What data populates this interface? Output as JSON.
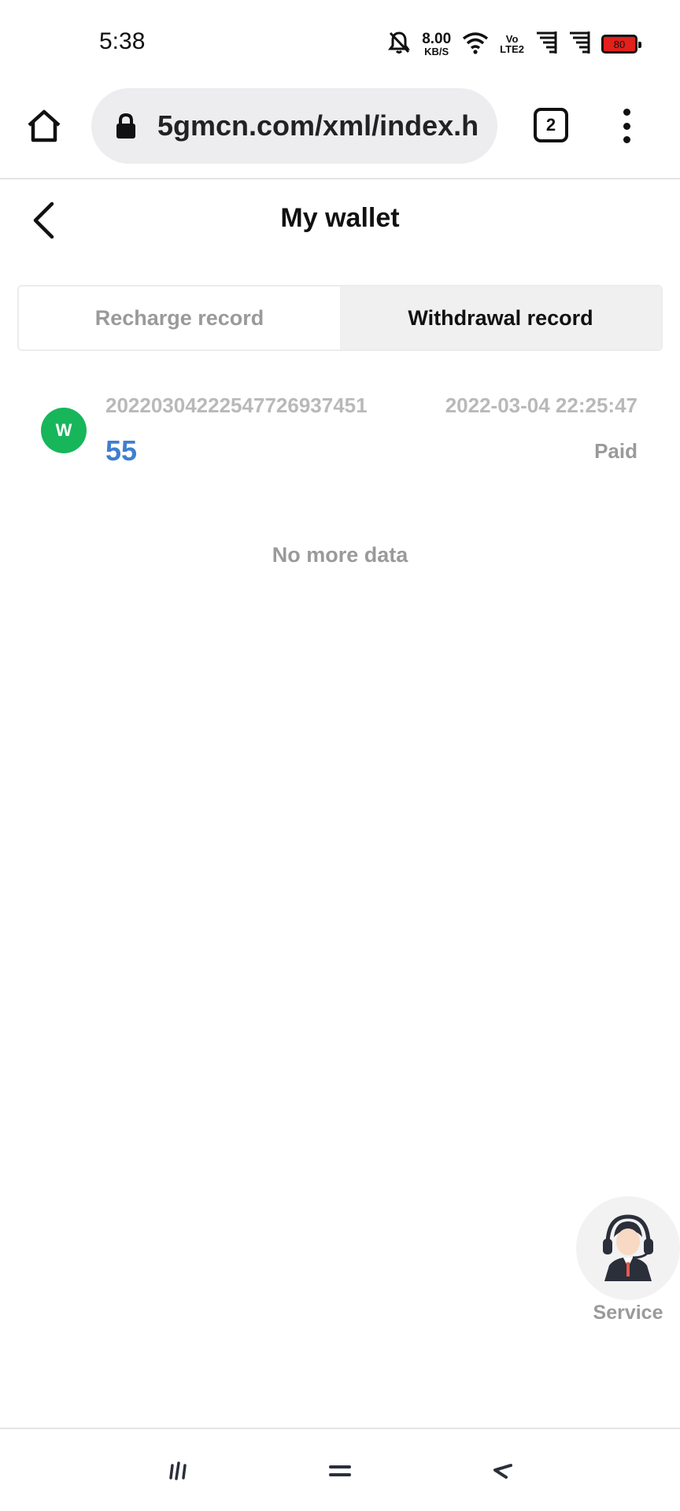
{
  "status_bar": {
    "time": "5:38",
    "net_speed_value": "8.00",
    "net_speed_unit": "KB/S",
    "volte_top": "Vo",
    "volte_bottom": "LTE2",
    "battery_level": "80",
    "battery_color": "#e3201b",
    "icons": [
      "bell-off-icon",
      "wifi-icon",
      "signal-icon",
      "signal-icon",
      "battery-icon"
    ]
  },
  "browser": {
    "url": "5gmcn.com/xml/index.h",
    "tab_count": "2",
    "icons": [
      "home-icon",
      "lock-icon",
      "menu-icon"
    ]
  },
  "header": {
    "title": "My wallet",
    "back_icon": "chevron-left-icon"
  },
  "tabs": [
    {
      "label": "Recharge record",
      "active": false
    },
    {
      "label": "Withdrawal record",
      "active": true
    }
  ],
  "records": [
    {
      "avatar_letter": "W",
      "avatar_color": "#17b65b",
      "order_no": "20220304222547726937451",
      "date": "2022-03-04 22:25:47",
      "amount": "55",
      "amount_color": "#3f7fd0",
      "status": "Paid"
    }
  ],
  "list_end_text": "No more data",
  "service": {
    "label": "Service",
    "icon": "customer-service-agent-icon"
  },
  "nav": {
    "icons": [
      "recents-icon",
      "home-nav-icon",
      "back-nav-icon"
    ]
  }
}
